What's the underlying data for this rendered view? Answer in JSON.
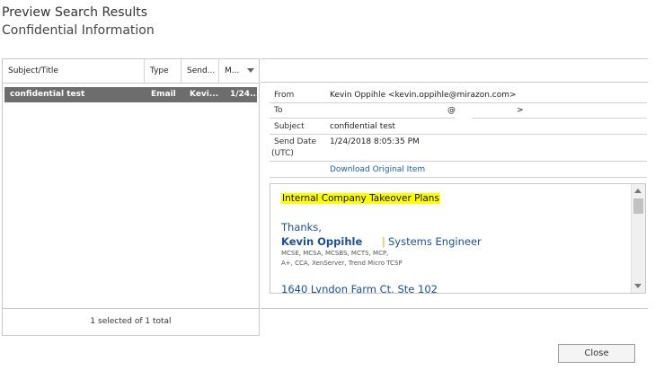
{
  "dialog": {
    "title": "Preview Search Results",
    "subtitle": "Confidential Information"
  },
  "grid": {
    "columns": [
      "Subject/Title",
      "Type",
      "Send...",
      "M..."
    ],
    "rows": [
      {
        "subject": "confidential test",
        "type": "Email",
        "sender": "Kevi...",
        "modified": "1/24..."
      }
    ],
    "status": "1 selected of 1 total"
  },
  "details": {
    "from_label": "From",
    "from_value": "Kevin Oppihle <kevin.oppihle@mirazon.com>",
    "to_label": "To",
    "to_value_at": "@",
    "to_value_gt": ">",
    "subject_label": "Subject",
    "subject_value": "confidential test",
    "senddate_label": "Send Date",
    "senddate_label2": "(UTC)",
    "senddate_value": "1/24/2018 8:05:35 PM",
    "download_link": "Download Original Item"
  },
  "message": {
    "highlight": "Internal Company Takeover Plans",
    "thanks": "Thanks,",
    "sig_name": "Kevin Oppihle",
    "sig_sep": "|",
    "sig_title": "Systems Engineer",
    "certs_line1": "MCSE, MCSA, MCSBS, MCTS, MCP,",
    "certs_line2": "A+, CCA, XenServer, Trend Micro TCSP",
    "address": "1640 Lyndon Farm Ct. Ste 102"
  },
  "buttons": {
    "close": "Close"
  },
  "colors": {
    "selected_row": "#6d6d6d",
    "highlight": "#ffff00",
    "signature_blue": "#1f4f8f",
    "link_blue": "#1f5fa8"
  }
}
